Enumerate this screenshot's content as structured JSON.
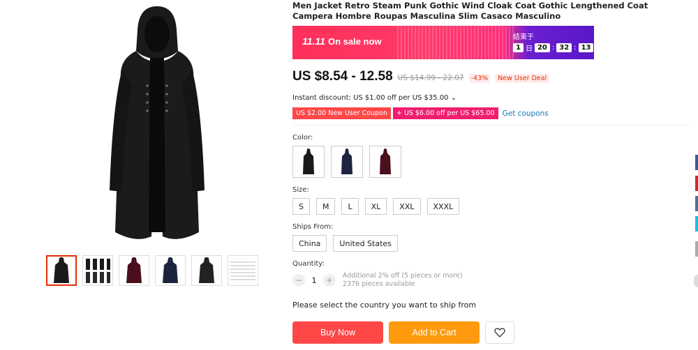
{
  "product": {
    "title": "Men Jacket Retro Steam Punk Gothic Wind Cloak Coat Gothic Lengthened Coat Campera Hombre Roupas Masculina Slim Casaco Masculino"
  },
  "sale": {
    "label_num": "11.11",
    "label_text": "On sale now",
    "ends_label": "结束于",
    "days": "1",
    "day_unit": "日",
    "hours": "20",
    "minutes": "32",
    "seconds": "13"
  },
  "pricing": {
    "price": "US $8.54 - 12.58",
    "original": "US $14.99 - 22.07",
    "discount": "-43%",
    "new_user_deal": "New User Deal",
    "instant_discount": "Instant discount: US $1.00 off per US $35.00 ⌄"
  },
  "coupons": {
    "new_user": "US $2.00 New User Coupon",
    "extra": "+ US $6.00 off per US $65.00",
    "get_coupons": "Get coupons"
  },
  "options": {
    "color_label": "Color:",
    "size_label": "Size:",
    "sizes": [
      "S",
      "M",
      "L",
      "XL",
      "XXL",
      "XXXL"
    ],
    "ships_from_label": "Ships From:",
    "ships_from": [
      "China",
      "United States"
    ],
    "quantity_label": "Quantity:",
    "quantity_value": "1",
    "quantity_minus": "−",
    "quantity_plus": "+",
    "bulk_discount": "Additional 2% off (5 pieces or more)",
    "pieces_available": "2376 pieces available"
  },
  "shipping_message": "Please select the country you want to ship from",
  "actions": {
    "buy_now": "Buy Now",
    "add_to_cart": "Add to Cart",
    "wishlist_icon": "heart-icon"
  },
  "colors": {
    "accent_red": "#ff4747",
    "accent_orange": "#ff9a0e",
    "link_blue": "#1577b5",
    "coat_black": "#1a1a1a",
    "coat_navy": "#1c2440",
    "coat_wine": "#4a0f1c"
  }
}
